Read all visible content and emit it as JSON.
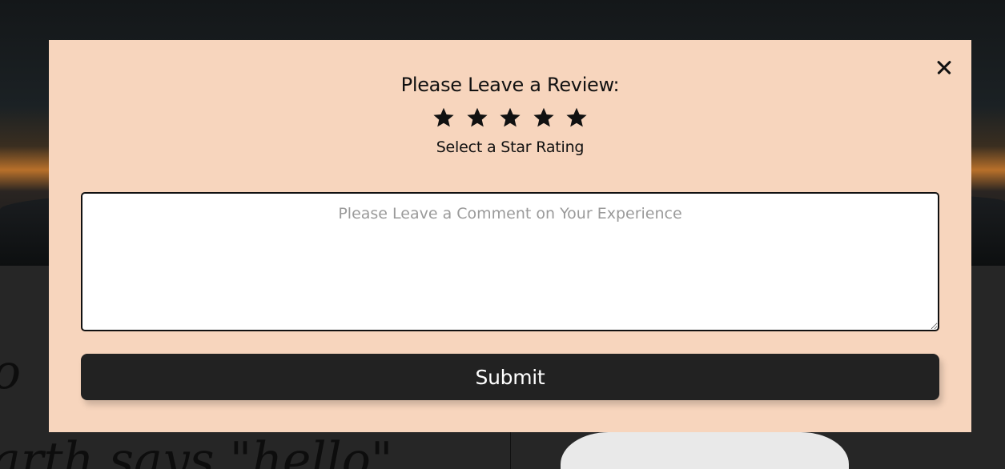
{
  "background": {
    "script_line_1": "o",
    "script_line_2": "arth says \"hello\""
  },
  "modal": {
    "title": "Please Leave a Review:",
    "rating": {
      "stars_total": 5,
      "stars_selected": 0,
      "star_icon": "star-icon",
      "hint": "Select a Star Rating"
    },
    "comment": {
      "value": "",
      "placeholder": "Please Leave a Comment on Your Experience"
    },
    "submit_label": "Submit",
    "close_icon": "close-icon"
  },
  "colors": {
    "modal_background": "#f7d5bd",
    "button_background": "#222222",
    "button_text": "#ffffff",
    "text": "#111111",
    "placeholder_text": "#9a9a9a"
  }
}
